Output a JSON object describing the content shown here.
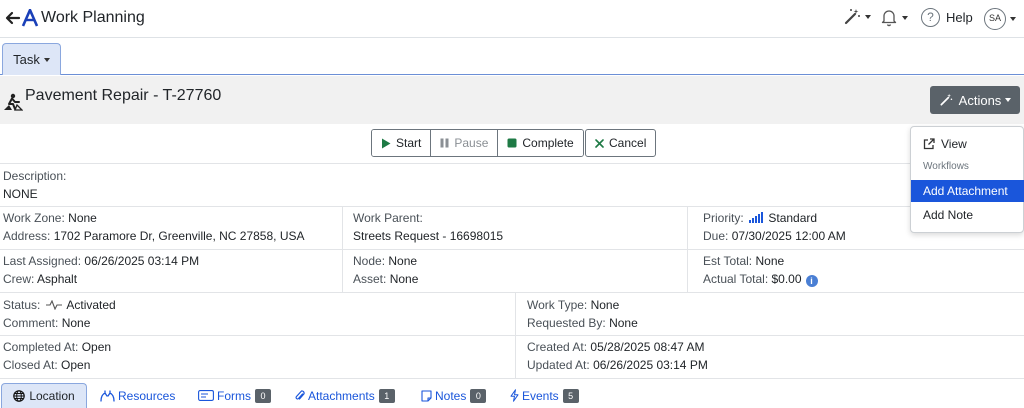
{
  "app": {
    "title": "Work Planning",
    "help_label": "Help",
    "avatar_initials": "SA",
    "accent_color": "#1a56db"
  },
  "tabs": {
    "task_label": "Task"
  },
  "task": {
    "title": "Pavement Repair - T-27760",
    "actions_label": "Actions"
  },
  "buttons": {
    "start": "Start",
    "pause": "Pause",
    "complete": "Complete",
    "cancel": "Cancel"
  },
  "dropdown": {
    "view": "View",
    "workflows_header": "Workflows",
    "add_attachment": "Add Attachment",
    "add_note": "Add Note"
  },
  "details": {
    "description_label": "Description:",
    "description_value": "NONE",
    "work_zone_label": "Work Zone:",
    "work_zone_value": "None",
    "address_label": "Address:",
    "address_value": "1702 Paramore Dr, Greenville, NC 27858, USA",
    "work_parent_label": "Work Parent:",
    "work_parent_value": "Streets Request - 16698015",
    "priority_label": "Priority:",
    "priority_value": "Standard",
    "due_label": "Due:",
    "due_value": "07/30/2025 12:00 AM",
    "last_assigned_label": "Last Assigned:",
    "last_assigned_value": "06/26/2025 03:14 PM",
    "crew_label": "Crew:",
    "crew_value": "Asphalt",
    "node_label": "Node:",
    "node_value": "None",
    "asset_label": "Asset:",
    "asset_value": "None",
    "est_total_label": "Est Total:",
    "est_total_value": "None",
    "actual_total_label": "Actual Total:",
    "actual_total_value": "$0.00",
    "status_label": "Status:",
    "status_value": "Activated",
    "comment_label": "Comment:",
    "comment_value": "None",
    "work_type_label": "Work Type:",
    "work_type_value": "None",
    "requested_by_label": "Requested By:",
    "requested_by_value": "None",
    "completed_at_label": "Completed At:",
    "completed_at_value": "Open",
    "closed_at_label": "Closed At:",
    "closed_at_value": "Open",
    "created_at_label": "Created At:",
    "created_at_value": "05/28/2025 08:47 AM",
    "updated_at_label": "Updated At:",
    "updated_at_value": "06/26/2025 03:14 PM"
  },
  "bottom_tabs": {
    "location": "Location",
    "resources": "Resources",
    "forms": "Forms",
    "forms_count": "0",
    "attachments": "Attachments",
    "attachments_count": "1",
    "notes": "Notes",
    "notes_count": "0",
    "events": "Events",
    "events_count": "5"
  }
}
